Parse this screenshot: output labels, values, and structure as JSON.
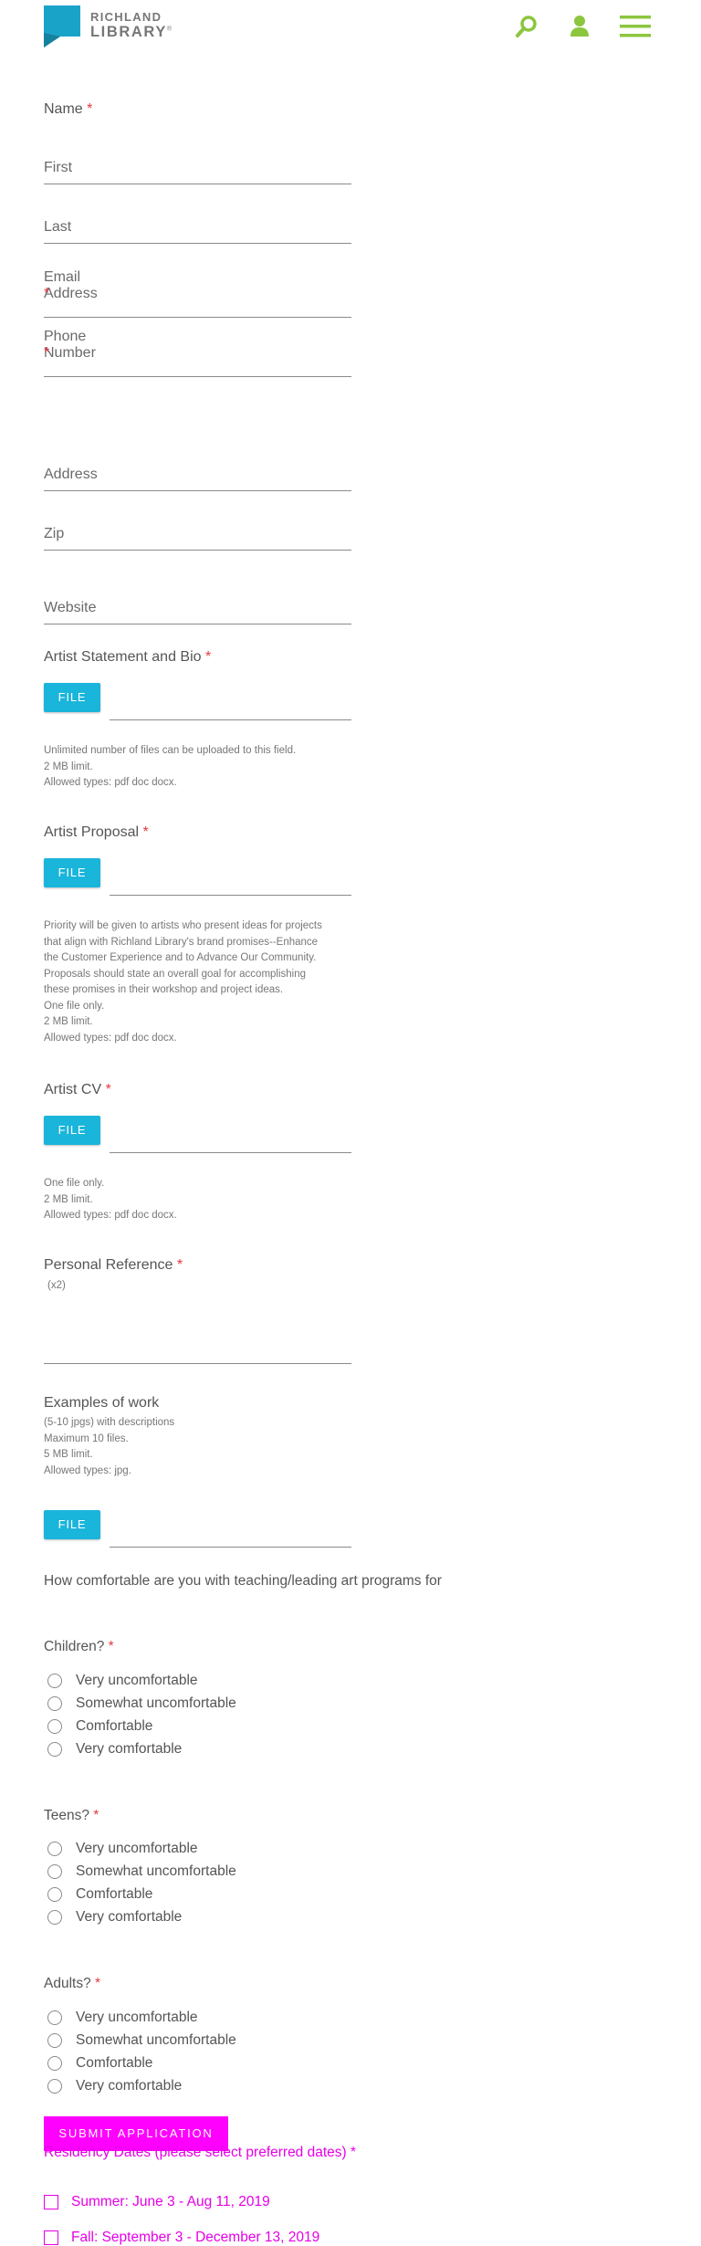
{
  "header": {
    "logo_line1": "RICHLAND",
    "logo_line2": "LIBRARY",
    "logo_mark": "®",
    "brand_color": "#1aa3c8",
    "icon_color": "#8cc63f",
    "icons": [
      "search-icon",
      "user-icon",
      "menu-icon"
    ]
  },
  "form": {
    "name": {
      "label": "Name",
      "required": "*",
      "first_placeholder": "First",
      "last_placeholder": "Last"
    },
    "email": {
      "label": "Email Address",
      "required": "*"
    },
    "phone": {
      "label": "Phone Number",
      "required": "*"
    },
    "address": {
      "placeholder": "Address"
    },
    "zip": {
      "placeholder": "Zip"
    },
    "website": {
      "placeholder": "Website"
    },
    "artist_statement": {
      "label": "Artist Statement and Bio",
      "required": "*",
      "button": "FILE",
      "help": [
        "Unlimited number of files can be uploaded to this field.",
        "2 MB limit.",
        "Allowed types: pdf doc docx."
      ]
    },
    "artist_proposal": {
      "label": "Artist Proposal",
      "required": "*",
      "button": "FILE",
      "help": [
        "Priority will be given to artists who present ideas for projects",
        "that align with Richland Library's brand promises--Enhance",
        "the Customer Experience and to Advance Our Community.",
        "Proposals should state an overall goal for accomplishing",
        "these promises in their workshop and project ideas.",
        "One file only.",
        "2 MB limit.",
        "Allowed types: pdf doc docx."
      ]
    },
    "artist_cv": {
      "label": "Artist CV",
      "required": "*",
      "button": "FILE",
      "help": [
        "One file only.",
        "2 MB limit.",
        "Allowed types: pdf doc docx."
      ]
    },
    "reference": {
      "label": "Personal Reference",
      "required": "*",
      "note": "(x2)"
    },
    "examples": {
      "label": "Examples of work",
      "button": "FILE",
      "help": [
        "(5-10 jpgs) with descriptions",
        "Maximum 10 files.",
        "5 MB limit.",
        "Allowed types: jpg."
      ]
    },
    "teaching_intro": "How comfortable are you with teaching/leading art programs for",
    "questions": [
      {
        "label": "Children?",
        "required": "*",
        "options": [
          "Very uncomfortable",
          "Somewhat uncomfortable",
          "Comfortable",
          "Very comfortable"
        ]
      },
      {
        "label": "Teens?",
        "required": "*",
        "options": [
          "Very uncomfortable",
          "Somewhat uncomfortable",
          "Comfortable",
          "Very comfortable"
        ]
      },
      {
        "label": "Adults?",
        "required": "*",
        "options": [
          "Very uncomfortable",
          "Somewhat uncomfortable",
          "Comfortable",
          "Very comfortable"
        ]
      }
    ],
    "submit": "SUBMIT APPLICATION",
    "residency": {
      "label": "Residency Dates (please select preferred dates)",
      "required": "*",
      "options": [
        "Summer: June 3 - Aug 11, 2019",
        "Fall: September 3 - December 13, 2019"
      ]
    }
  },
  "colors": {
    "file_button": "#1ab5db",
    "submit_button": "#ff00ff",
    "required_star": "#e5383b",
    "residency_text": "#e600e6"
  }
}
